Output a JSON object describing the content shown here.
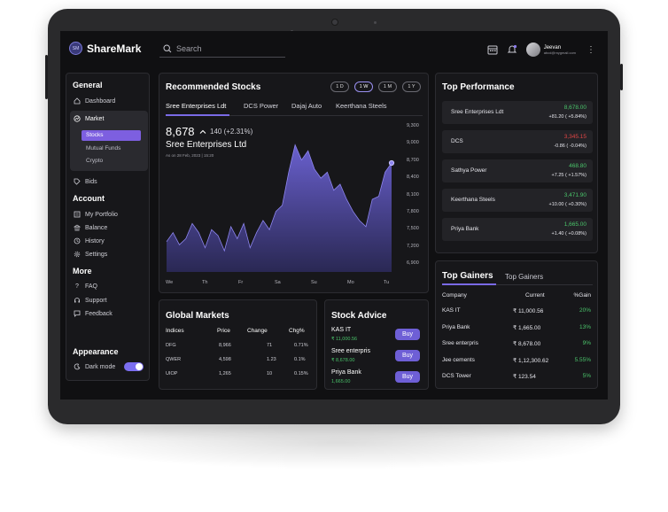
{
  "app": {
    "logo_badge": "SM",
    "title": "ShareMark"
  },
  "search": {
    "placeholder": "Search"
  },
  "user": {
    "name": "Jeevan",
    "email": "abcd@mygmail.com"
  },
  "sidebar": {
    "general": "General",
    "dashboard": "Dashboard",
    "market": "Market",
    "stocks": "Stocks",
    "mutual_funds": "Mutual Funds",
    "crypto": "Crypto",
    "bids": "Bids",
    "account": "Account",
    "portfolio": "My Portfolio",
    "balance": "Balance",
    "history": "History",
    "settings": "Settings",
    "more": "More",
    "faq": "FAQ",
    "support": "Support",
    "feedback": "Feedback",
    "appearance": "Appearance",
    "dark_mode": "Dark mode",
    "dark_mode_on": true
  },
  "recommended": {
    "title": "Recommended Stocks",
    "ranges": [
      "1 D",
      "1 W",
      "1 M",
      "1 Y"
    ],
    "active_range": "1 W",
    "tabs": [
      "Sree Enterprises Ldt",
      "DCS Power",
      "Dajaj Auto",
      "Keerthana Steels"
    ],
    "price": "8,678",
    "change": "140 (+2.31%)",
    "stock_name": "Sree Enterprises Ltd",
    "as_of": "As on 28 Feb, 2023 | 15:20"
  },
  "chart_data": {
    "type": "area",
    "y_ticks": [
      "9,300",
      "9,000",
      "8,700",
      "8,400",
      "8,100",
      "7,800",
      "7,500",
      "7,200",
      "6,900"
    ],
    "x_ticks": [
      "We",
      "Th",
      "Fr",
      "Sa",
      "Su",
      "Mo",
      "Tu"
    ],
    "ylim": [
      6900,
      9300
    ],
    "values": [
      7400,
      7550,
      7350,
      7450,
      7700,
      7550,
      7300,
      7600,
      7500,
      7250,
      7650,
      7450,
      7700,
      7300,
      7550,
      7750,
      7600,
      7900,
      8000,
      8550,
      9000,
      8750,
      8900,
      8600,
      8450,
      8550,
      8250,
      8350,
      8100,
      7900,
      7750,
      7650,
      8100,
      8150,
      8550,
      8700
    ]
  },
  "top_performance": {
    "title": "Top Performance",
    "rows": [
      {
        "name": "Sree Enterprises Ldt",
        "price": "8,678.00",
        "change": "+81.20 ( +5.84%)",
        "up": true
      },
      {
        "name": "DCS",
        "price": "3,345.15",
        "change": "-0.86 ( -0.04%)",
        "up": false
      },
      {
        "name": "Sathya Power",
        "price": "468.80",
        "change": "+7.25 ( +1.57%)",
        "up": true
      },
      {
        "name": "Keerthana Steels",
        "price": "3,471.90",
        "change": "+10.00 ( +0.30%)",
        "up": true
      },
      {
        "name": "Priya Bank",
        "price": "1,665.00",
        "change": "+1.40 ( +0.08%)",
        "up": true
      }
    ]
  },
  "top_gainers": {
    "tab_active": "Top Gainers",
    "tab_other": "Top Gainers",
    "headers": [
      "Company",
      "Current",
      "%Gain"
    ],
    "rows": [
      {
        "company": "KAS IT",
        "current": "₹ 11,000.56",
        "gain": "20%"
      },
      {
        "company": "Priya Bank",
        "current": "₹ 1,665.00",
        "gain": "13%"
      },
      {
        "company": "Sree enterpris",
        "current": "₹ 8,678.00",
        "gain": "9%"
      },
      {
        "company": "Jee cements",
        "current": "₹ 1,12,300.62",
        "gain": "5.55%"
      },
      {
        "company": "DCS Tower",
        "current": "₹ 123.54",
        "gain": "5%"
      }
    ]
  },
  "global_markets": {
    "title": "Global Markets",
    "headers": [
      "Indices",
      "Price",
      "Change",
      "Chg%"
    ],
    "rows": [
      {
        "index": "DFG",
        "price": "8,966",
        "change": "71",
        "chg": "0.71%"
      },
      {
        "index": "QWER",
        "price": "4,598",
        "change": "1.23",
        "chg": "0.1%"
      },
      {
        "index": "UIOP",
        "price": "1,265",
        "change": "10",
        "chg": "0.15%"
      }
    ]
  },
  "stock_advice": {
    "title": "Stock Advice",
    "buy_label": "Buy",
    "items": [
      {
        "name": "KAS IT",
        "price": "₹ 11,000.56"
      },
      {
        "name": "Sree enterpris",
        "price": "₹ 8,678.00"
      },
      {
        "name": "Priya Bank",
        "price": "1,665.00"
      }
    ]
  },
  "colors": {
    "accent": "#7a6ae6",
    "green": "#4ac36a",
    "red": "#e04545",
    "background": "#101012"
  }
}
